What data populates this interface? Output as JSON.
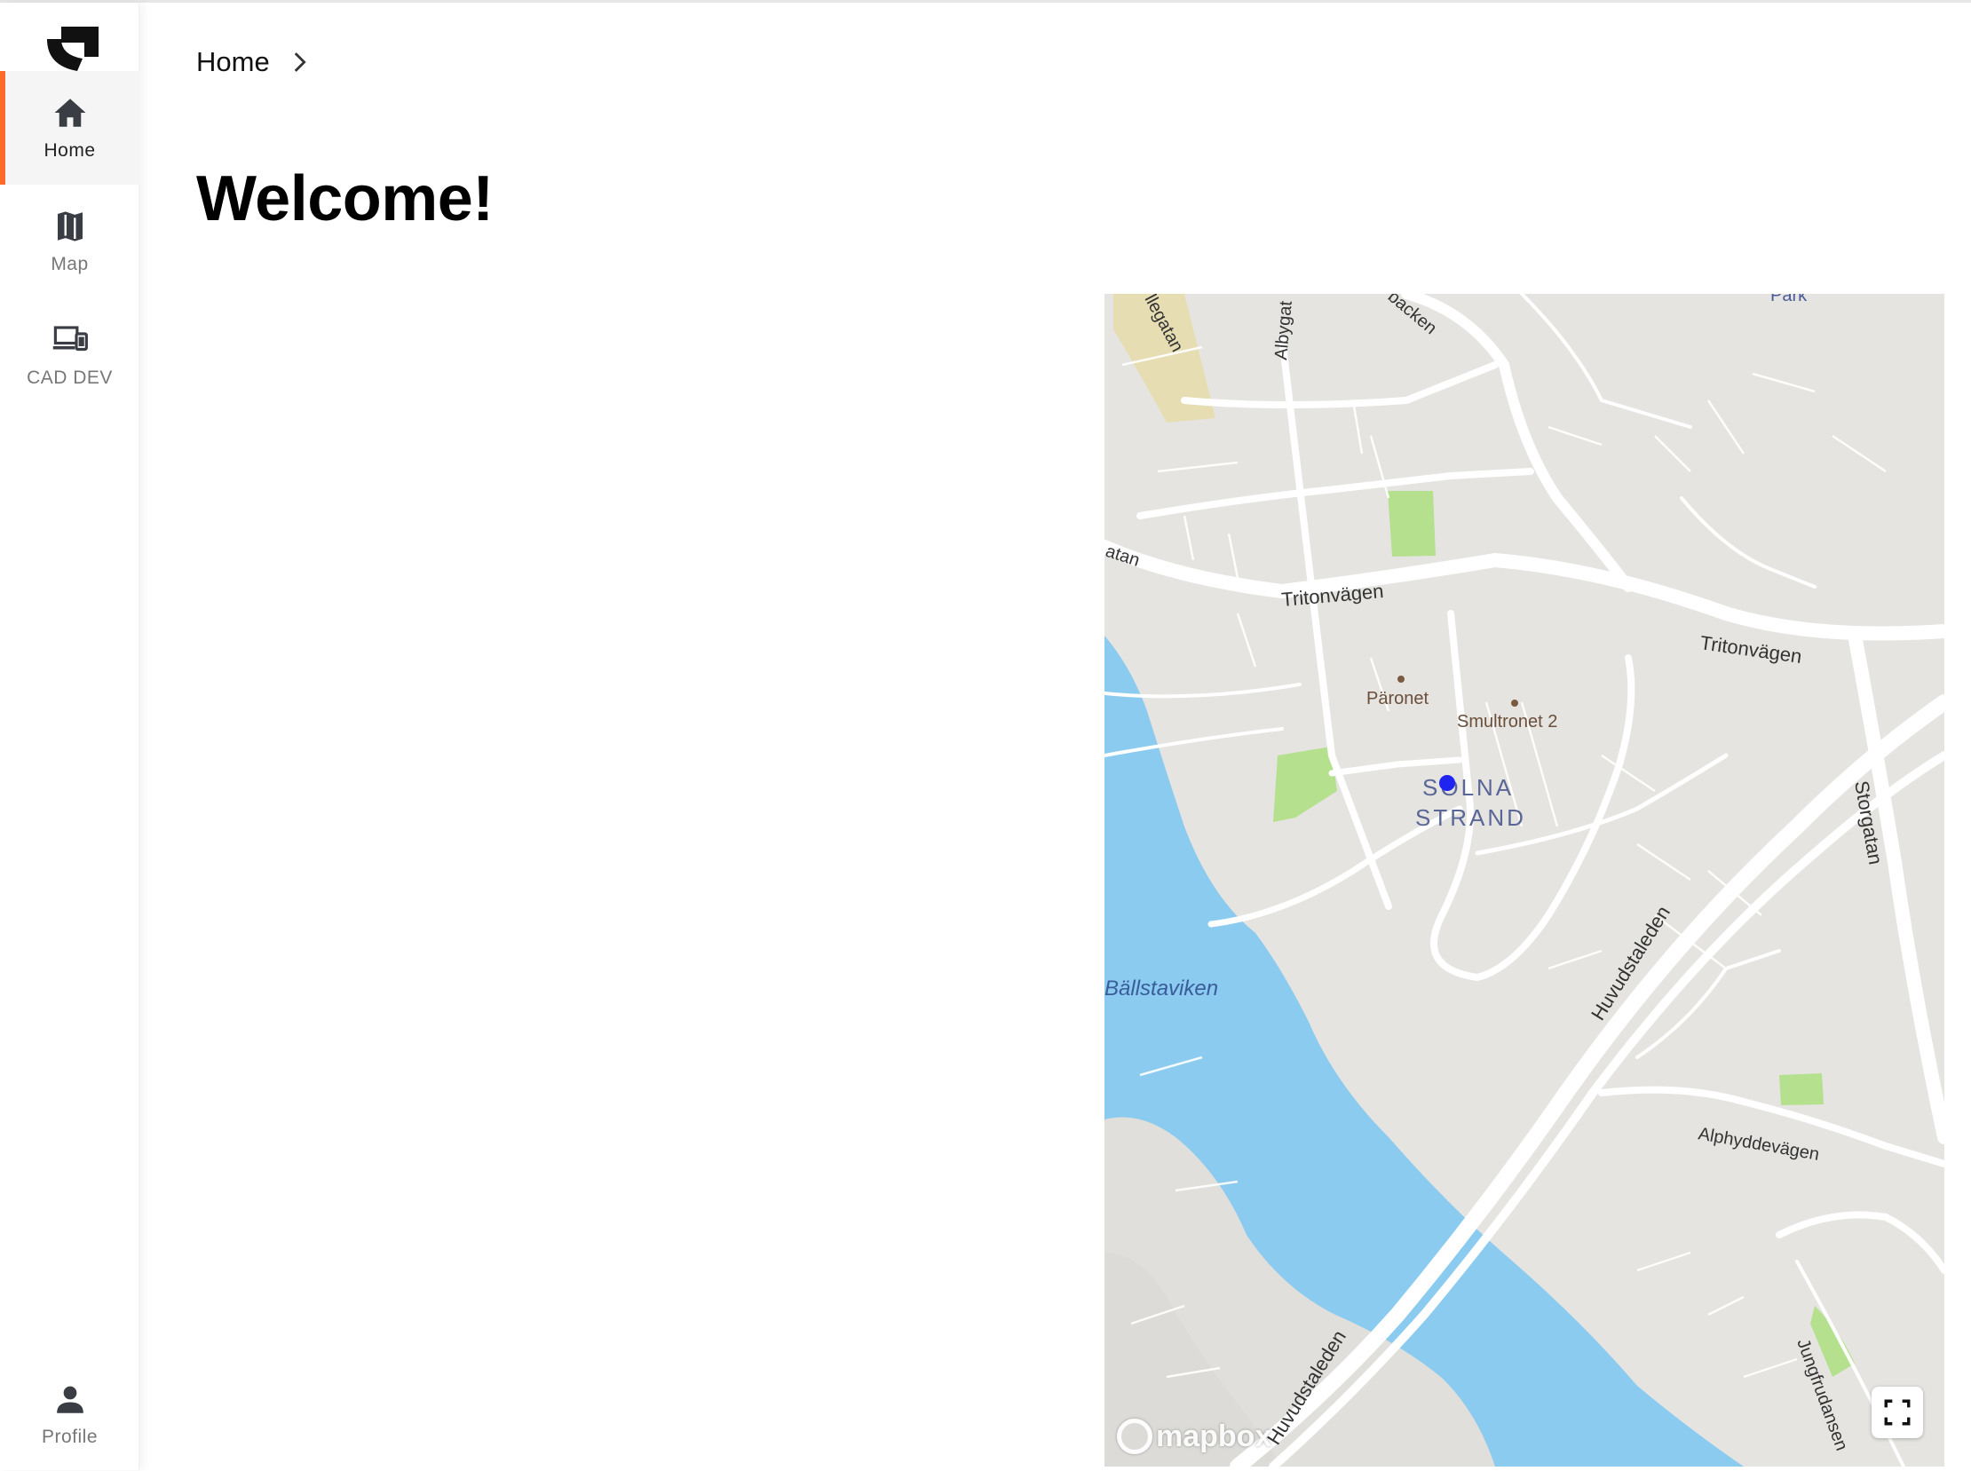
{
  "sidebar": {
    "logo_icon": "company-logo-icon",
    "items": [
      {
        "label": "Home",
        "icon": "home-icon",
        "active": true
      },
      {
        "label": "Map",
        "icon": "map-icon",
        "active": false
      },
      {
        "label": "CAD DEV",
        "icon": "devices-icon",
        "active": false
      }
    ],
    "profile": {
      "label": "Profile",
      "icon": "person-icon"
    }
  },
  "breadcrumb": {
    "items": [
      "Home"
    ],
    "separator_icon": "chevron-right-icon"
  },
  "main": {
    "title": "Welcome!"
  },
  "map": {
    "attribution": "mapbox",
    "fullscreen_icon": "fullscreen-icon",
    "labels": {
      "street_tritonvagen_1": "Tritonvägen",
      "street_tritonvagen_2": "Tritonvägen",
      "street_storgatan": "Storgatan",
      "street_huvudstaleden_1": "Huvudstaleden",
      "street_huvudstaleden_2": "Huvudstaleden",
      "street_alphyddevagen": "Alphyddevägen",
      "street_jungfrudansen": "Jungfrudansen",
      "street_albygatan": "Albygat",
      "street_top_left": "llegatan",
      "street_top_backen": "backen",
      "street_left_gatan": "atan",
      "park_top": "Park",
      "poi_paronet": "Päronet",
      "poi_smultronet": "Smultronet 2",
      "area_line1": "SOLNA",
      "area_line2": "STRAND",
      "water_ballstaviken": "Bällstaviken"
    },
    "colors": {
      "land": "#e5e4e1",
      "water": "#8acbef",
      "park": "#b5e08e",
      "road": "#ffffff",
      "marker": "#1f24f0",
      "accent": "#ff6a2a"
    }
  }
}
